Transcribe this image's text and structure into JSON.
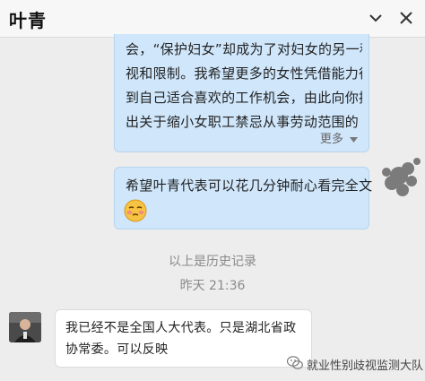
{
  "header": {
    "title": "叶青"
  },
  "messages": {
    "first_lines": [
      "会，“保护妇女”却成为了对妇女的另一种歧",
      "视和限制。我希望更多的女性凭借能力得",
      "到自己适合喜欢的工作机会，由此向你提",
      "出关于缩小女职工禁忌从事劳动范围的 ..."
    ],
    "more_label": "更多",
    "second_text": "希望叶青代表可以花几分钟耐心看完全文",
    "history_label": "以上是历史记录",
    "time_label": "昨天 21:36",
    "reply_lines": [
      "我已经不是全国人大代表。只是湖北省政",
      "协常委。可以反映"
    ]
  },
  "watermark": {
    "text": "就业性别歧视监测大队"
  },
  "colors": {
    "bubble_self": "#cfe6fb",
    "bubble_other": "#ffffff",
    "background": "#ededed"
  },
  "icons": [
    "chevron-down-icon",
    "close-icon",
    "emoji-icon",
    "wechat-icon"
  ]
}
